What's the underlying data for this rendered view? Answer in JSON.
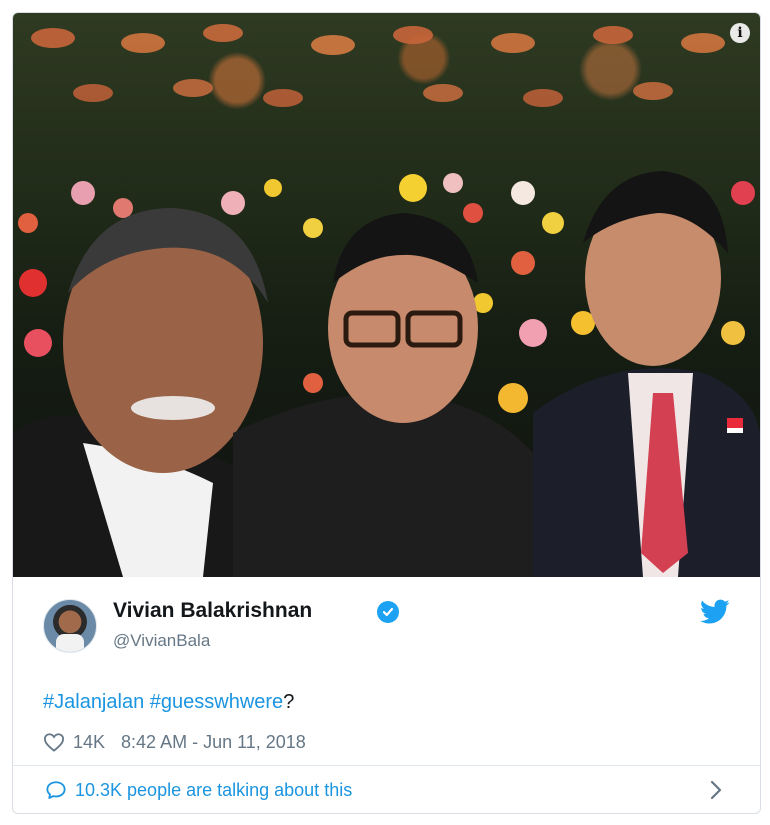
{
  "tweet": {
    "author_name": "Vivian Balakrishnan",
    "author_handle": "@VivianBala",
    "text_parts": {
      "hashtag1": "#Jalanjalan",
      "space": " ",
      "hashtag2": "#guesswhwere",
      "suffix": "?"
    },
    "likes": "14K",
    "timestamp": "8:42 AM - Jun 11, 2018",
    "conversation_label": "10.3K people are talking about this"
  },
  "icons": {
    "info": "info-icon",
    "verified": "verified-badge-icon",
    "twitter": "twitter-bird-icon",
    "heart": "heart-icon",
    "comment": "comment-icon",
    "chevron": "chevron-right-icon"
  },
  "colors": {
    "accent": "#1da1f2",
    "link": "#1b95e0",
    "muted": "#657786",
    "text": "#14171a"
  }
}
